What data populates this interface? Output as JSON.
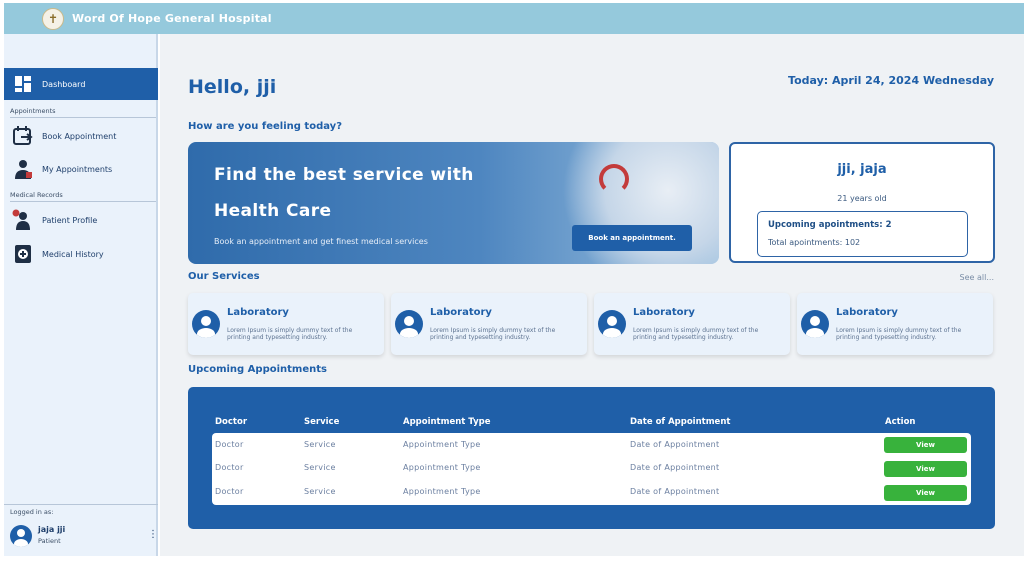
{
  "header": {
    "title": "Word Of Hope General Hospital",
    "logo_icon": "cross-emblem-icon"
  },
  "sidebar": {
    "items": [
      {
        "label": "Dashboard",
        "icon": "dashboard-icon",
        "active": true
      },
      {
        "label": "Book Appointment",
        "icon": "calendar-add-icon"
      },
      {
        "label": "My Appointments",
        "icon": "doctor-icon"
      },
      {
        "label": "Patient Profile",
        "icon": "patient-profile-icon"
      },
      {
        "label": "Medical History",
        "icon": "medical-history-icon"
      }
    ],
    "sections": {
      "appointments": "Appointments",
      "medical_records": "Medical Records"
    },
    "logged_in": {
      "label": "Logged in as:",
      "name": "jaja jji",
      "role": "Patient"
    }
  },
  "main": {
    "greeting": "Hello, jji",
    "today": "Today: April 24, 2024 Wednesday",
    "feeling": "How are you feeling today?",
    "banner": {
      "line1": "Find the best service with",
      "line2": "Health Care",
      "subtitle": "Book an appointment and get finest medical services",
      "button": "Book an appointment."
    },
    "profile": {
      "name": "jji, jaja",
      "age": "21 years old",
      "upcoming": "Upcoming apointments: 2",
      "total": "Total apointments: 102"
    },
    "services": {
      "title": "Our Services",
      "see_all": "See all...",
      "items": [
        {
          "title": "Laboratory",
          "desc": "Lorem Ipsum is simply dummy text of the printing and typesetting industry."
        },
        {
          "title": "Laboratory",
          "desc": "Lorem Ipsum is simply dummy text of the printing and typesetting industry."
        },
        {
          "title": "Laboratory",
          "desc": "Lorem Ipsum is simply dummy text of the printing and typesetting industry."
        },
        {
          "title": "Laboratory",
          "desc": "Lorem Ipsum is simply dummy text of the printing and typesetting industry."
        }
      ]
    },
    "appointments": {
      "title": "Upcoming Appointments",
      "columns": [
        "Doctor",
        "Service",
        "Appointment Type",
        "Date of Appointment",
        "Action"
      ],
      "rows": [
        {
          "doctor": "Doctor",
          "service": "Service",
          "type": "Appointment Type",
          "date": "Date of Appointment",
          "action": "View"
        },
        {
          "doctor": "Doctor",
          "service": "Service",
          "type": "Appointment Type",
          "date": "Date of Appointment",
          "action": "View"
        },
        {
          "doctor": "Doctor",
          "service": "Service",
          "type": "Appointment Type",
          "date": "Date of Appointment",
          "action": "View"
        }
      ]
    }
  },
  "colors": {
    "primary": "#1f5fa8",
    "header": "#95c9dc",
    "sidebar": "#eaf2fb",
    "view_button": "#38b23c"
  }
}
